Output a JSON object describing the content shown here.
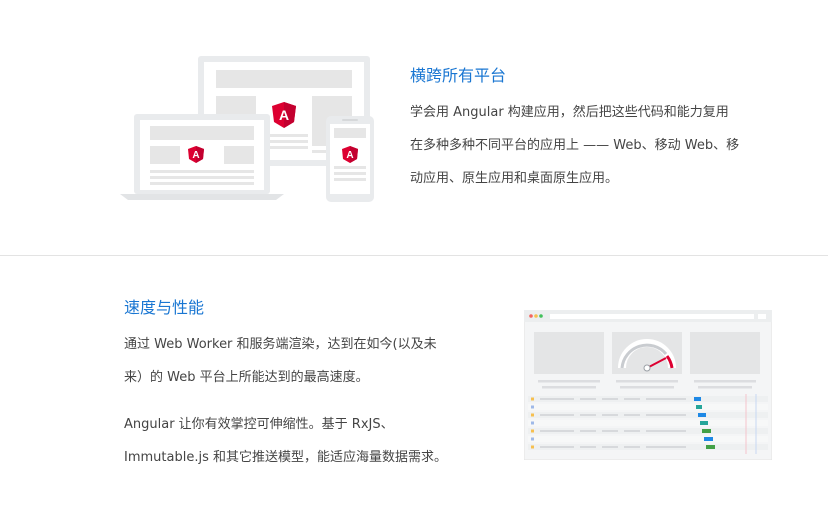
{
  "section_cross_platform": {
    "title": "横跨所有平台",
    "lines": [
      "学会用 Angular 构建应用，然后把这些代码和能力复用",
      "在多种多种不同平台的应用上 —— Web、移动 Web、移",
      "动应用、原生应用和桌面原生应用。"
    ],
    "logo_letter": "A"
  },
  "section_speed": {
    "title": "速度与性能",
    "para1_lines": [
      "通过 Web Worker 和服务端渲染，达到在如今(以及未",
      "来）的 Web 平台上所能达到的最高速度。"
    ],
    "para2_lines": [
      "Angular 让你有效掌控可伸缩性。基于 RxJS、",
      "Immutable.js 和其它推送模型，能适应海量数据需求。"
    ]
  },
  "colors": {
    "accent": "#1976d2",
    "angular_red": "#dd0031",
    "device_gray": "#e8e8e8"
  }
}
